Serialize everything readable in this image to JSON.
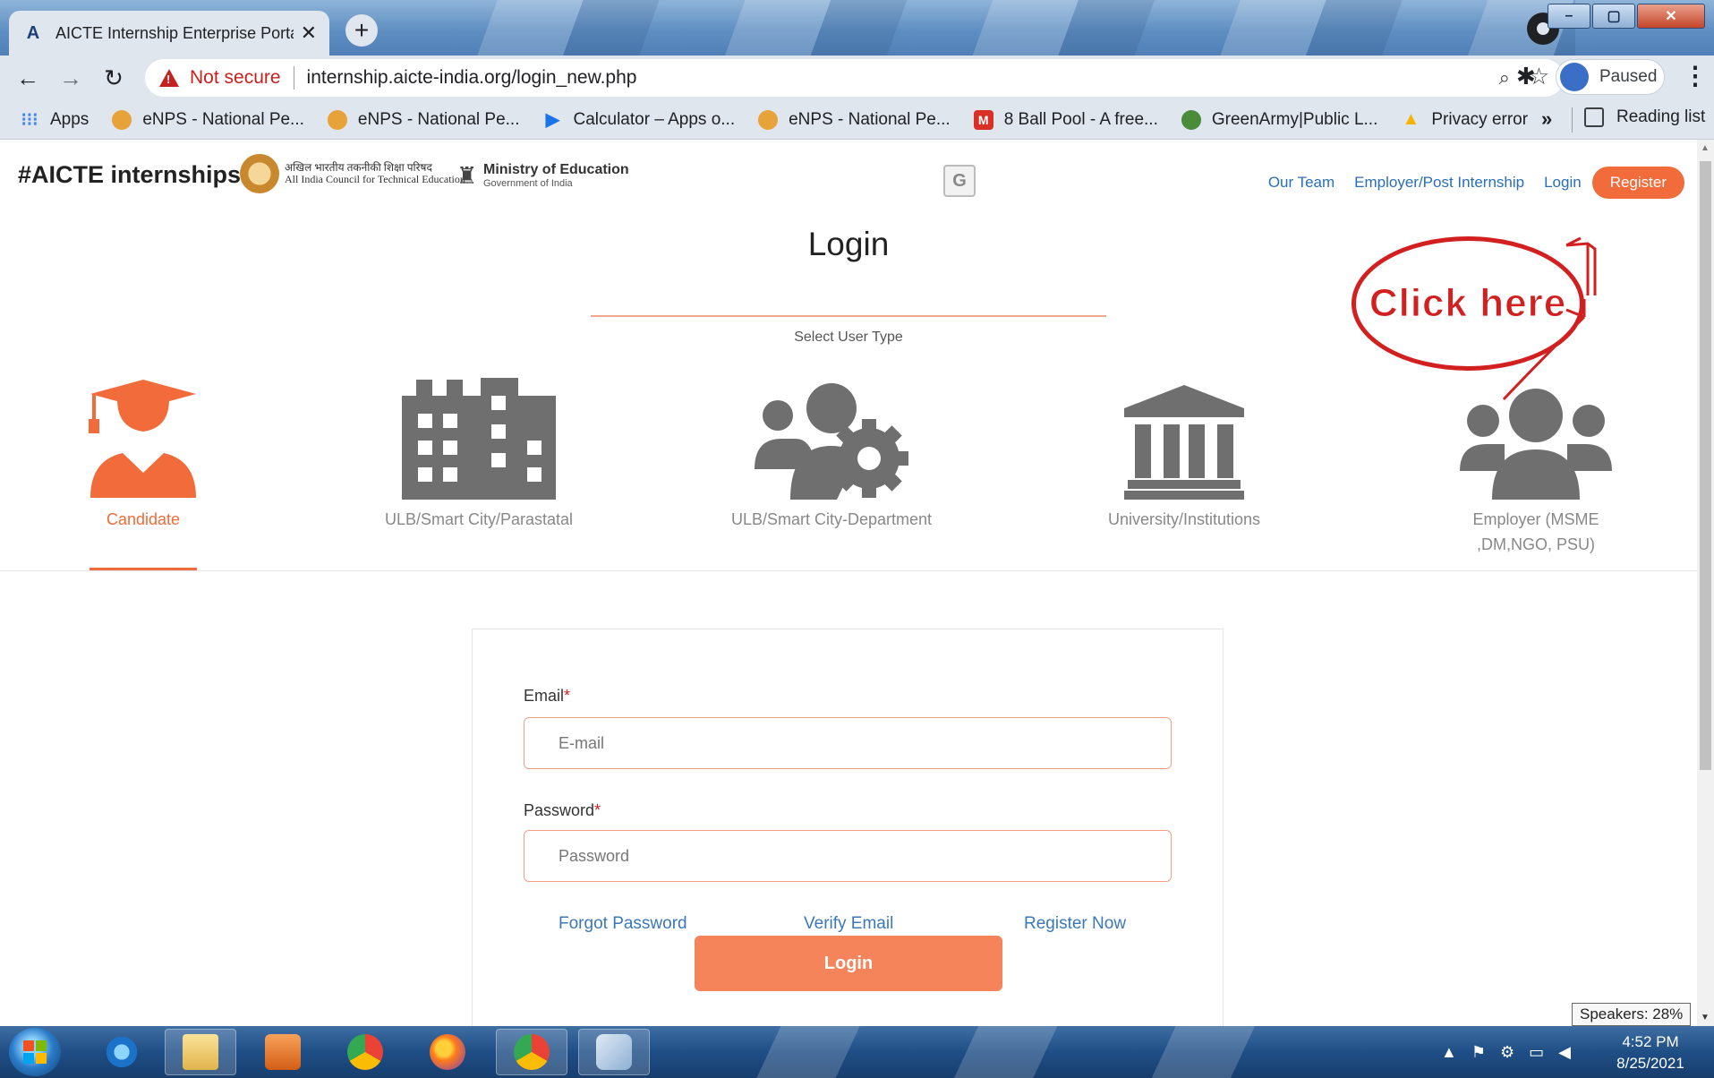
{
  "browser": {
    "tab_title": "AICTE Internship Enterprise Porta",
    "new_tab_symbol": "+",
    "security_label": "Not secure",
    "url": "internship.aicte-india.org/login_new.php",
    "profile_status": "Paused",
    "bookmarks": [
      {
        "label": "Apps",
        "icon": "apps-grid-icon"
      },
      {
        "label": "eNPS - National Pe...",
        "icon": "enps-icon"
      },
      {
        "label": "eNPS - National Pe...",
        "icon": "enps-icon"
      },
      {
        "label": "Calculator – Apps o...",
        "icon": "play-store-icon"
      },
      {
        "label": "eNPS - National Pe...",
        "icon": "enps-icon"
      },
      {
        "label": "8 Ball Pool - A free...",
        "icon": "miniclip-icon"
      },
      {
        "label": "GreenArmy|Public L...",
        "icon": "greenarmy-icon"
      },
      {
        "label": "Privacy error",
        "icon": "drive-icon"
      }
    ],
    "bookmarks_overflow": "»",
    "reading_list": "Reading list"
  },
  "header": {
    "brand": "#AICTE internships",
    "aicte_logo_line1": "अखिल भारतीय तकनीकी शिक्षा परिषद",
    "aicte_logo_line2": "All India Council for Technical Education",
    "moe_title": "Ministry of Education",
    "moe_subtitle": "Government of India",
    "nav": {
      "our_team": "Our Team",
      "employer": "Employer/Post Internship",
      "login": "Login",
      "register": "Register"
    }
  },
  "annotation": {
    "text": "Click here",
    "color": "#d21f1f"
  },
  "login": {
    "title": "Login",
    "subtitle": "Select User Type",
    "user_types": [
      {
        "label": "Candidate",
        "icon": "graduate-icon",
        "active": true
      },
      {
        "label": "ULB/Smart City/Parastatal",
        "icon": "building-icon",
        "active": false
      },
      {
        "label": "ULB/Smart City-Department",
        "icon": "users-gear-icon",
        "active": false
      },
      {
        "label": "University/Institutions",
        "icon": "institution-icon",
        "active": false
      },
      {
        "label": "Employer (MSME ,DM,NGO, PSU)",
        "icon": "group-icon",
        "active": false
      }
    ],
    "email_label": "Email",
    "email_placeholder": "E-mail",
    "password_label": "Password",
    "password_placeholder": "Password",
    "required_mark": "*",
    "forgot_password": "Forgot Password",
    "verify_email": "Verify Email",
    "register_now": "Register Now",
    "submit": "Login"
  },
  "tooltip": {
    "speakers": "Speakers: 28%"
  },
  "taskbar": {
    "time": "4:52 PM",
    "date": "8/25/2021",
    "apps": [
      "internet-explorer-icon",
      "file-explorer-icon",
      "media-player-icon",
      "chrome-icon",
      "firefox-icon",
      "chrome-remote-icon",
      "paint-icon"
    ]
  },
  "colors": {
    "accent": "#f26b3a",
    "link": "#2a6fb5",
    "icon_gray": "#6f6f6f"
  }
}
